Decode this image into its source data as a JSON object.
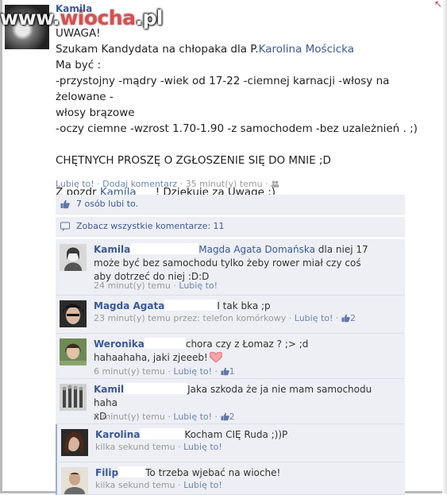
{
  "watermark": {
    "pre": "www.",
    "hl": "wiocha",
    "post": ".pl"
  },
  "corner_mark": "↖",
  "post": {
    "author": "Kamila",
    "lines": [
      "UWAGA!",
      "Szukam Kandydata na chłopaka dla P.",
      "Ma być :",
      "-przystojny -mądry -wiek od 17-22 -ciemnej karnacji -włosy na żelowane -",
      "włosy brązowe",
      "-oczy ciemne -wzrost 1.70-1.90 -z samochodem -bez uzależnień . ;)",
      "CHĘTNYCH PROSZĘ O ZGŁOSZENIE SIĘ DO MNIE ;D",
      "Z pozdr ",
      "! Dziękuje za Uwagę ;)"
    ],
    "tag_person": "Karolina Mościcka",
    "tag_signature": "Kamila",
    "meta": {
      "like": "Lubię to!",
      "sep": " · ",
      "comment": "Dodaj komentarz",
      "time": "35 minut(y) temu"
    }
  },
  "feedback": {
    "likes": "7 osób lubi to.",
    "view_all": "Zobacz wszystkie komentarze: 11"
  },
  "comments": [
    {
      "name": "Kamila",
      "tag": "Magda Agata Domańska",
      "text_after_tag": " dla niej 17 może być bez samochodu tylko żeby rower miał czy coś aby dotrzeć do niej :D:D",
      "time": "24 minut(y) temu",
      "like": "Lubię to!"
    },
    {
      "name": "Magda Agata",
      "text": "I tak bka ;p",
      "time": "23 minut(y) temu przez: telefon komórkowy",
      "like": "Lubię to!",
      "likes": "2"
    },
    {
      "name": "Weronika",
      "text": "chora czy z Łomaz ? ;> ;d",
      "text2": "hahaahaha, jaki zjeeeb!",
      "time": "6 minut(y) temu",
      "like": "Lubię to!",
      "likes": "1"
    },
    {
      "name": "Kamil",
      "text": "Jaka szkoda że ja nie mam samochodu haha",
      "text2": "xD",
      "time": "4 minut(y) temu",
      "like": "Lubię to!",
      "likes": "2"
    },
    {
      "name": "Karolina",
      "text": "Kocham CIĘ Ruda ;))P",
      "time": "kilka sekund temu",
      "like": "Lubię to!"
    },
    {
      "name": "Filip",
      "text": "To trzeba wjebać na wioche!",
      "time": "kilka sekund temu",
      "like": "Lubię to!"
    }
  ],
  "colors": {
    "link": "#3b5998",
    "meta": "#999999",
    "ufi_bg": "#edeff4",
    "watermark_accent": "#d83a3a"
  }
}
